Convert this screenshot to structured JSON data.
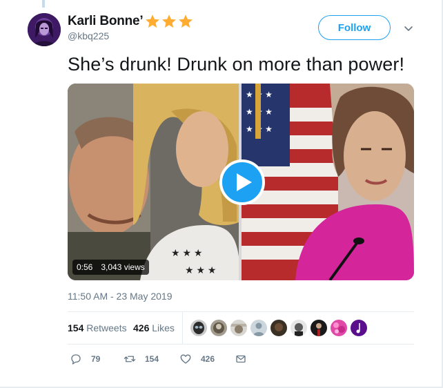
{
  "tweet": {
    "author": {
      "display_name": "Karli Bonne’",
      "badge_icons": [
        "star-icon",
        "star-icon",
        "star-icon"
      ],
      "handle": "@kbq225"
    },
    "follow_label": "Follow",
    "text": "She’s drunk! Drunk on more than power!",
    "media": {
      "duration": "0:56",
      "views": "3,043 views"
    },
    "timestamp": "11:50 AM - 23 May 2019",
    "stats": {
      "retweets_count": "154",
      "retweets_label": "Retweets",
      "likes_count": "426",
      "likes_label": "Likes"
    },
    "actions": {
      "replies": "79",
      "retweets": "154",
      "likes": "426"
    }
  },
  "colors": {
    "accent": "#1da1f2",
    "star": "#ffac33",
    "muted_text": "#657786"
  }
}
